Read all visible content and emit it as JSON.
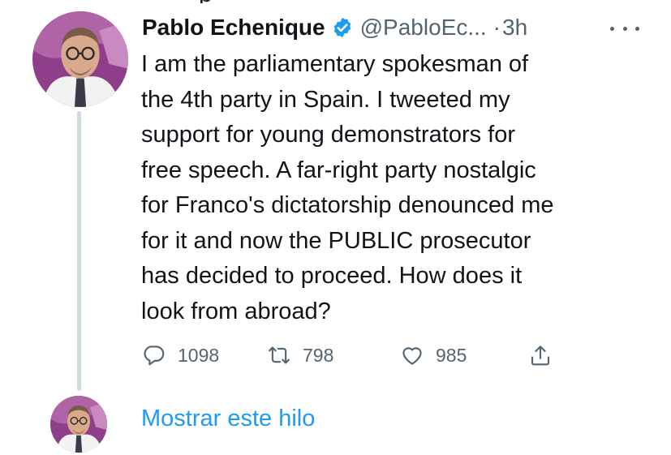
{
  "top_fragment": "p",
  "tweet": {
    "author_name": "Pablo Echenique",
    "handle": "@PabloEc...",
    "separator": "·",
    "time": "3h",
    "text_lines": [
      "I am the parliamentary spokesman of",
      "the 4th party in Spain. I tweeted my",
      "support for young demonstrators for",
      "free speech. A far-right party nostalgic",
      "for Franco's dictatorship denounced me",
      "for it and now the PUBLIC prosecutor",
      "has decided to proceed. How does it",
      "look from abroad?"
    ],
    "replies": "1098",
    "retweets": "798",
    "likes": "985"
  },
  "show_thread_label": "Mostrar este hilo",
  "icons": {
    "verified": "verified-badge-icon",
    "more": "more-options-icon",
    "reply": "reply-bubble-icon",
    "retweet": "retweet-icon",
    "like": "heart-icon",
    "share": "share-icon"
  },
  "colors": {
    "accent": "#1d9bf0",
    "text": "#0f1419",
    "muted": "#536471",
    "thread_line": "#cfd9de"
  }
}
